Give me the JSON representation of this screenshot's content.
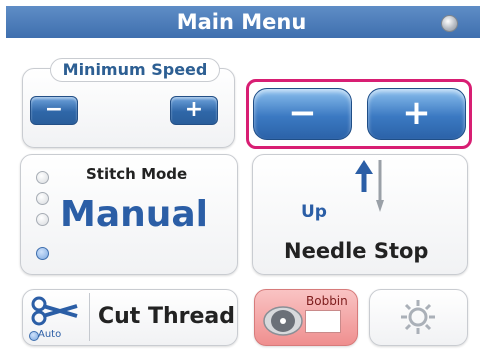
{
  "title": "Main Menu",
  "min_speed": {
    "label": "Minimum Speed",
    "minus_symbol": "−",
    "plus_symbol": "+"
  },
  "speed_controls": {
    "minus_symbol": "−",
    "plus_symbol": "+"
  },
  "stitch_mode": {
    "title": "Stitch Mode",
    "value": "Manual",
    "options_count": 4,
    "selected_index": 3
  },
  "needle_stop": {
    "direction": "Up",
    "label": "Needle Stop"
  },
  "cut_thread": {
    "label": "Cut Thread",
    "auto_label": "Auto"
  },
  "bobbin": {
    "label": "Bobbin"
  },
  "colors": {
    "accent_blue": "#3f6fae",
    "highlight_magenta": "#d81e73",
    "bobbin_pink": "#ef8f8f"
  },
  "icons": [
    "status-led-icon",
    "scissors-icon",
    "needle-icon",
    "up-arrow-icon",
    "bobbin-icon",
    "gear-icon"
  ]
}
